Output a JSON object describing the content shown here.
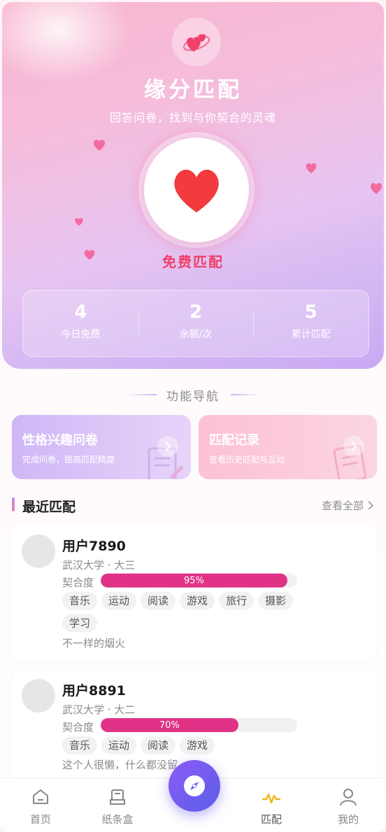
{
  "hero": {
    "title": "缘分匹配",
    "subtitle": "回答问卷，找到与你契合的灵魂",
    "match_button_label": "免费匹配",
    "stats": [
      {
        "value": "4",
        "label": "今日免费"
      },
      {
        "value": "2",
        "label": "余额/次"
      },
      {
        "value": "5",
        "label": "累计匹配"
      }
    ]
  },
  "nav": {
    "title": "功能导航",
    "features": [
      {
        "title": "性格兴趣问卷",
        "subtitle": "完成问卷，提高匹配精度"
      },
      {
        "title": "匹配记录",
        "subtitle": "查看历史匹配与互动"
      }
    ]
  },
  "recent": {
    "title": "最近匹配",
    "view_all": "查看全部",
    "compat_label": "契合度",
    "matches": [
      {
        "name": "用户7890",
        "school": "武汉大学 · 大三",
        "compat_text": "95%",
        "compat_value": 0.95,
        "tags": [
          "音乐",
          "运动",
          "阅读",
          "游戏",
          "旅行",
          "摄影",
          "学习"
        ],
        "bio": "不一样的烟火"
      },
      {
        "name": "用户8891",
        "school": "武汉大学 · 大二",
        "compat_text": "70%",
        "compat_value": 0.7,
        "tags": [
          "音乐",
          "运动",
          "阅读",
          "游戏"
        ],
        "bio": "这个人很懒，什么都没留"
      }
    ]
  },
  "tabbar": {
    "tabs": [
      {
        "label": "首页",
        "icon": "home-icon"
      },
      {
        "label": "纸条盒",
        "icon": "note-box-icon"
      },
      {
        "label": "匹配",
        "icon": "match-wave-icon"
      },
      {
        "label": "我的",
        "icon": "profile-icon"
      }
    ],
    "center_icon": "compass-icon"
  },
  "colors": {
    "accent_pink": "#f0406a",
    "compat_fill": "#e03388",
    "center_button": "#7b5cf0"
  }
}
